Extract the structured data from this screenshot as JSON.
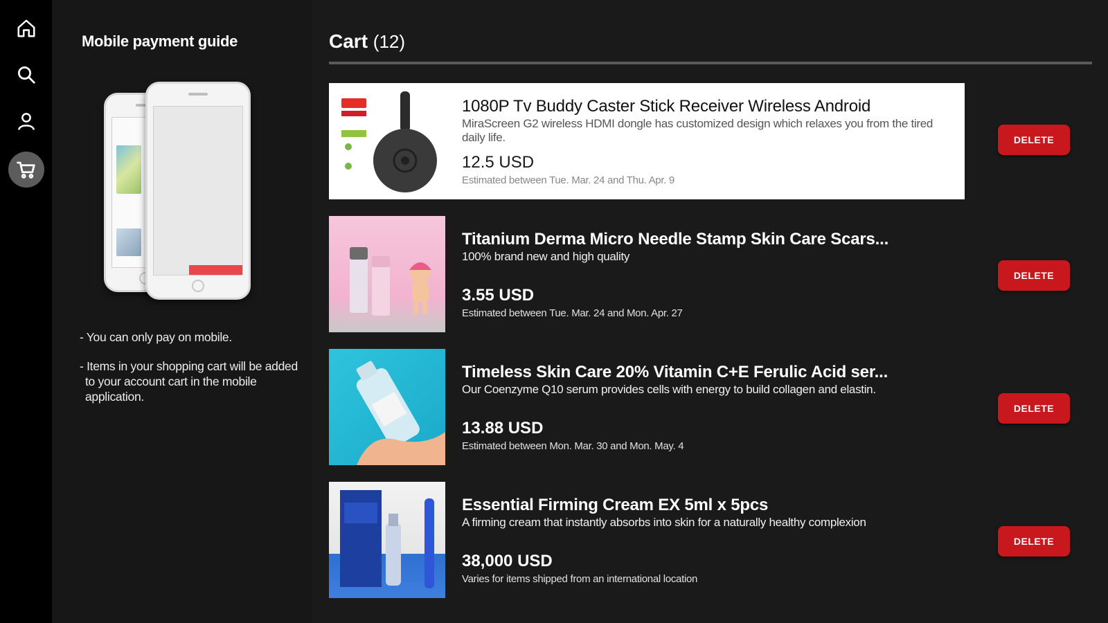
{
  "nav": {
    "items": [
      {
        "icon": "home-icon",
        "active": false
      },
      {
        "icon": "search-icon",
        "active": false
      },
      {
        "icon": "user-icon",
        "active": false
      },
      {
        "icon": "cart-icon",
        "active": true
      }
    ]
  },
  "guide": {
    "title": "Mobile payment guide",
    "notes": [
      "- You can only pay on mobile.",
      "- Items in your shopping cart will be added to your account cart in the mobile application."
    ]
  },
  "cart": {
    "title": "Cart",
    "count": "(12)",
    "delete_label": "DELETE",
    "items": [
      {
        "title": "1080P Tv Buddy Caster Stick Receiver Wireless Android",
        "description": "MiraScreen G2 wireless HDMI dongle has customized design which relaxes you from the tired daily life.",
        "price": "12.5 USD",
        "eta": "Estimated between Tue. Mar. 24 and Thu. Apr. 9",
        "selected": true
      },
      {
        "title": "Titanium Derma Micro Needle Stamp Skin Care Scars...",
        "description": "100% brand new and high quality",
        "price": "3.55 USD",
        "eta": "Estimated between Tue. Mar. 24 and Mon. Apr. 27",
        "selected": false
      },
      {
        "title": "Timeless Skin Care 20% Vitamin C+E Ferulic Acid ser...",
        "description": "Our Coenzyme Q10 serum provides cells with energy to build collagen and elastin.",
        "price": "13.88 USD",
        "eta": "Estimated between Mon. Mar. 30 and Mon. May. 4",
        "selected": false
      },
      {
        "title": "Essential Firming Cream EX 5ml x 5pcs",
        "description": "A firming cream that instantly absorbs into skin for a naturally healthy complexion",
        "price": "38,000 USD",
        "eta": "Varies for items shipped from an international location",
        "selected": false
      }
    ]
  },
  "colors": {
    "accent_red": "#c8181e",
    "background": "#1a1a1a",
    "rail": "#000000"
  }
}
